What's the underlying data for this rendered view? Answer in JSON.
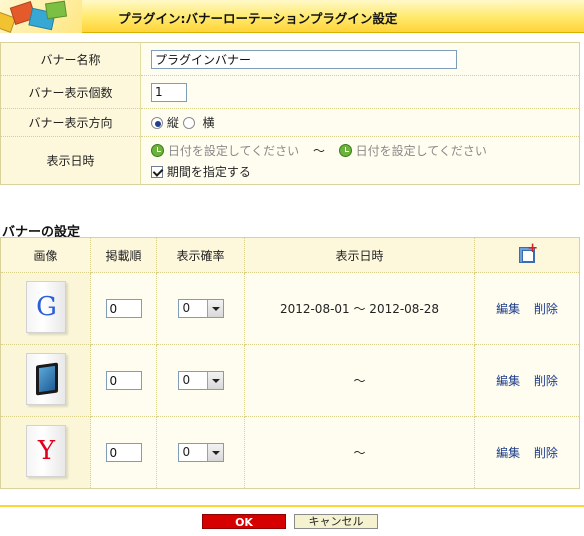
{
  "title": "プラグイン:バナーローテーションプラグイン設定",
  "form": {
    "banner_name": {
      "label": "バナー名称",
      "value": "プラグインバナー"
    },
    "banner_count": {
      "label": "バナー表示個数",
      "value": "1"
    },
    "direction": {
      "label": "バナー表示方向",
      "options": [
        "縦",
        "横"
      ],
      "selected": "縦"
    },
    "display_period": {
      "label": "表示日時",
      "from_placeholder": "日付を設定してください",
      "separator": "～",
      "to_placeholder": "日付を設定してください",
      "checkbox_label": "期間を指定する",
      "checked": true
    }
  },
  "banner_section": {
    "title": "バナーの設定",
    "columns": [
      "画像",
      "掲載順",
      "表示確率",
      "表示日時"
    ],
    "rows": [
      {
        "image": "google-banner",
        "glyph": "G",
        "glyph_color": "#2a5fd8",
        "order": "0",
        "probability": "0",
        "period": "2012-08-01 ～ 2012-08-28",
        "edit": "編集",
        "delete": "削除"
      },
      {
        "image": "tablet-banner",
        "glyph": "",
        "glyph_color": "",
        "order": "0",
        "probability": "0",
        "period": "～",
        "edit": "編集",
        "delete": "削除"
      },
      {
        "image": "yahoo-banner",
        "glyph": "Y",
        "glyph_color": "#e0001b",
        "order": "0",
        "probability": "0",
        "period": "～",
        "edit": "編集",
        "delete": "削除"
      }
    ]
  },
  "footer": {
    "ok": "OK",
    "cancel": "キャンセル"
  },
  "colors": {
    "accent": "#ffd43a",
    "ok_button": "#d70000",
    "link": "#1c3a8b"
  }
}
